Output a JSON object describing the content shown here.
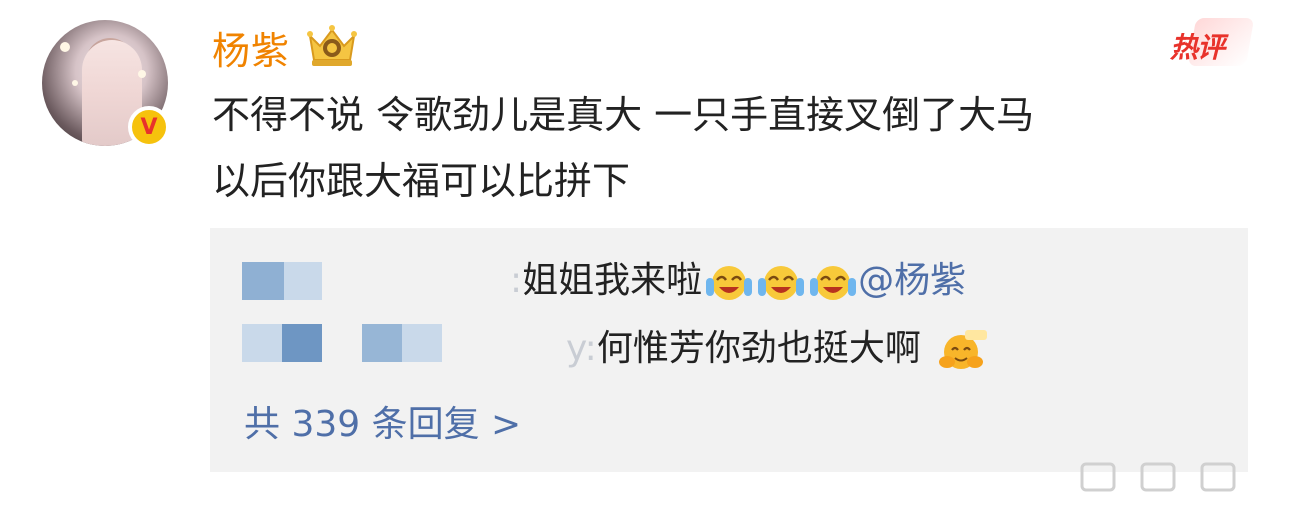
{
  "post": {
    "username": "杨紫",
    "verified_badge": "V",
    "hot_tag": "热评",
    "comment_line1": "不得不说 令歌劲儿是真大 一只手直接叉倒了大马",
    "comment_line2": "以后你跟大福可以比拼下"
  },
  "replies": [
    {
      "text": "姐姐我来啦",
      "mention": "@杨紫",
      "username_suffix": ":"
    },
    {
      "text": "何惟芳你劲也挺大啊",
      "username_suffix": "y:"
    }
  ],
  "more_replies": "共 339 条回复 >",
  "colors": {
    "username": "#f08300",
    "link": "#4f6fa8",
    "hot": "#e8322b",
    "reply_bg": "#f2f2f2"
  },
  "icons": [
    "crown-badge-icon",
    "verified-v-icon",
    "laughing-tears-emoji",
    "hugging-emoji",
    "share-icon",
    "comment-icon",
    "like-icon"
  ]
}
